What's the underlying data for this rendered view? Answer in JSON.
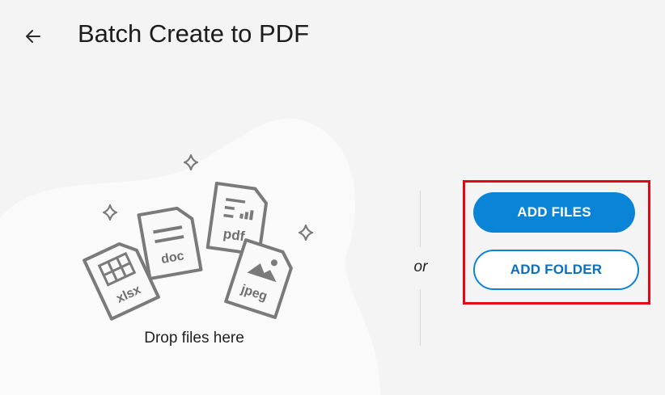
{
  "header": {
    "title": "Batch Create to PDF",
    "back_icon": "arrow-left-icon"
  },
  "drop_zone": {
    "label": "Drop files here",
    "file_types": [
      "xlsx",
      "doc",
      "pdf",
      "jpeg"
    ]
  },
  "separator": {
    "label": "or"
  },
  "actions": {
    "add_files_label": "ADD FILES",
    "add_folder_label": "ADD FOLDER"
  },
  "colors": {
    "accent": "#0a84d6",
    "highlight_border": "#e30613",
    "background": "#f4f4f4",
    "icon_gray": "#7a7a7a"
  }
}
